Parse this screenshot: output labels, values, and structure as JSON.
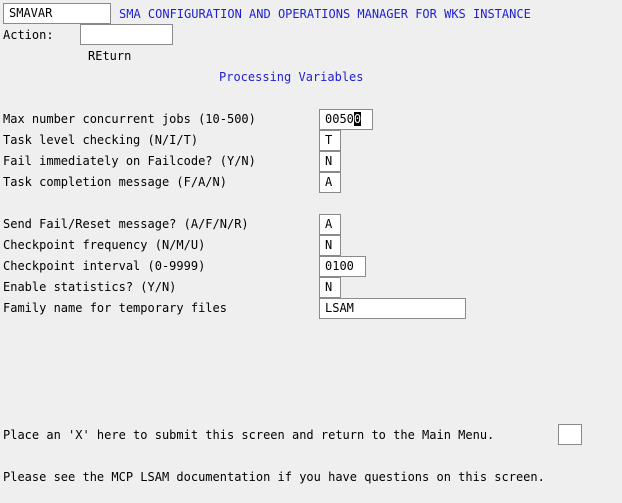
{
  "header": {
    "screen_id": "SMAVAR",
    "title": "SMA CONFIGURATION AND OPERATIONS MANAGER FOR WKS INSTANCE"
  },
  "action": {
    "label": "Action:",
    "value": "",
    "return_label": "REturn"
  },
  "section_title": "Processing Variables",
  "fields": {
    "max_jobs": {
      "label": "Max number concurrent jobs (10-500)",
      "value_prefix": "0050",
      "value_cursor": "0"
    },
    "task_level": {
      "label": "Task level checking (N/I/T)",
      "value": "T"
    },
    "fail_immediately": {
      "label": "Fail immediately on Failcode? (Y/N)",
      "value": "N"
    },
    "task_completion": {
      "label": "Task completion message (F/A/N)",
      "value": "A"
    },
    "send_fail_reset": {
      "label": "Send Fail/Reset message? (A/F/N/R)",
      "value": "A"
    },
    "checkpoint_freq": {
      "label": "Checkpoint frequency (N/M/U)",
      "value": "N"
    },
    "checkpoint_interval": {
      "label": "Checkpoint interval (0-9999)",
      "value": "0100"
    },
    "enable_stats": {
      "label": "Enable statistics? (Y/N)",
      "value": "N"
    },
    "family_name": {
      "label": "Family name for temporary files",
      "value": "LSAM"
    }
  },
  "footer": {
    "submit_label": "Place an 'X' here to submit this screen and return to the Main Menu.",
    "submit_value": "",
    "help_text": "Please see the MCP LSAM documentation if you have questions on this screen."
  }
}
